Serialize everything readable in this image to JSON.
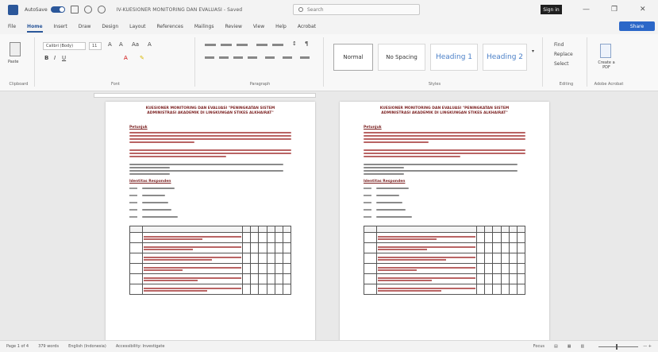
{
  "titlebar": {
    "autosave": "AutoSave",
    "autosave_state": "On",
    "doc_title": "IV-KUESIONER MONITORING DAN EVALUASI - Saved",
    "search_placeholder": "Search",
    "signin": "Sign in",
    "minimize": "—",
    "restore": "❐",
    "close": "✕"
  },
  "menu": {
    "items": [
      "File",
      "Home",
      "Insert",
      "Draw",
      "Design",
      "Layout",
      "References",
      "Mailings",
      "Review",
      "View",
      "Help",
      "Acrobat"
    ],
    "active": "Home",
    "share": "Share"
  },
  "ribbon": {
    "clipboard": {
      "paste": "Paste",
      "label": "Clipboard"
    },
    "font": {
      "name": "Calibri (Body)",
      "size": "11",
      "label": "Font"
    },
    "paragraph": {
      "label": "Paragraph"
    },
    "styles": {
      "items": [
        "Normal",
        "No Spacing",
        "Heading 1",
        "Heading 2"
      ],
      "label": "Styles"
    },
    "editing": {
      "find": "Find",
      "replace": "Replace",
      "select": "Select",
      "label": "Editing"
    },
    "adobe": {
      "create": "Create a PDF",
      "label": "Adobe Acrobat"
    }
  },
  "document": {
    "page_title_1": "KUESIONER MONITORING DAN EVALUASI \"PENINGKATAN SISTEM",
    "page_title_2": "ADMINISTRASI AKADEMIK DI LINGKUNGAN STIKES ALKHAIRAT\"",
    "section_intro": "Petunjuk",
    "section_identity": "Identitas Responden"
  },
  "status": {
    "page": "Page 1 of 4",
    "words": "379 words",
    "language": "English (Indonesia)",
    "accessibility": "Accessibility: Investigate",
    "focus": "Focus",
    "zoom": "—  +"
  },
  "colors": {
    "accent": "#2b579a",
    "share": "#2b67c8",
    "doc_text": "#7a1f1f"
  }
}
